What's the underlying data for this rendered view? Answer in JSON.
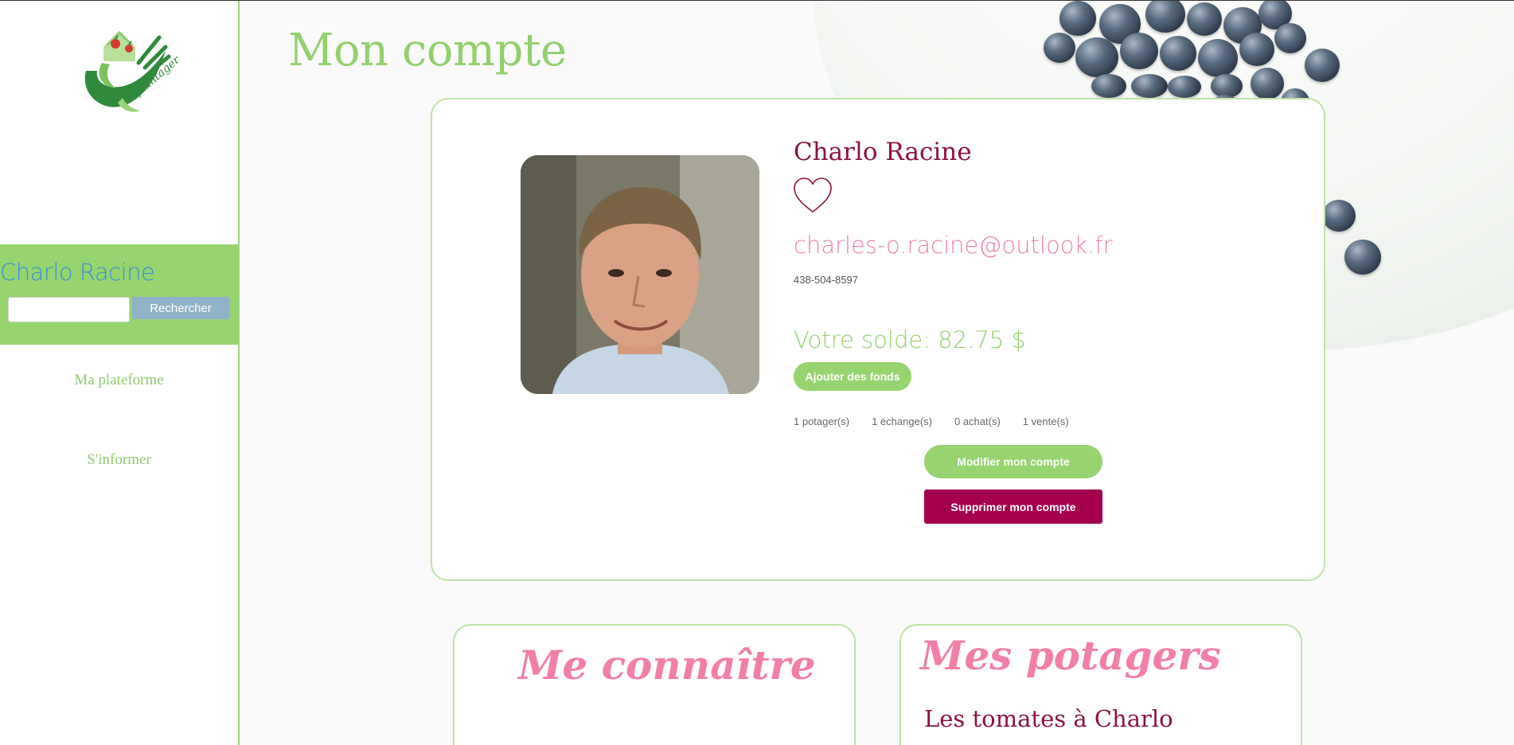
{
  "sidebar": {
    "logo_text": "plantager",
    "search": {
      "name": "Charlo Racine",
      "input_value": "",
      "button_label": "Rechercher"
    },
    "nav": [
      {
        "label": "Ma plateforme"
      },
      {
        "label": "S'informer"
      }
    ]
  },
  "main": {
    "title": "Mon compte",
    "profile": {
      "name": "Charlo Racine",
      "email": "charles-o.racine@outlook.fr",
      "phone": "438-504-8597",
      "balance": "Votre solde: 82.75 $",
      "add_funds_label": "Ajouter des fonds",
      "stats": [
        {
          "label": "1 potager(s)"
        },
        {
          "label": "1 échange(s)"
        },
        {
          "label": "0 achat(s)"
        },
        {
          "label": "1 vente(s)"
        }
      ],
      "modify_label": "Modifier mon compte",
      "delete_label": "Supprimer mon compte"
    },
    "about": {
      "title": "Me connaître"
    },
    "gardens": {
      "title": "Mes potagers",
      "items": [
        {
          "name": "Les tomates à Charlo"
        }
      ]
    }
  },
  "colors": {
    "accent_green": "#96d46f",
    "title_green": "#93d06d",
    "name_burgundy": "#8c1245",
    "email_pink": "#ee7fae",
    "danger": "#a5004d",
    "search_name_blue": "#3f8fd8"
  },
  "icons": [
    "logo-icon",
    "heart-icon",
    "profile-photo"
  ]
}
